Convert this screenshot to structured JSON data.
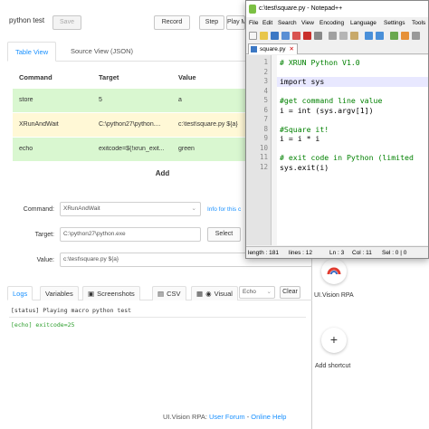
{
  "uivision": {
    "macro_name": "python test",
    "buttons": {
      "save": "Save",
      "record": "Record",
      "step": "Step",
      "play": "Play M"
    },
    "tabs": [
      "Table View",
      "Source View (JSON)"
    ],
    "columns": [
      "Command",
      "Target",
      "Value"
    ],
    "rows": [
      {
        "command": "store",
        "target": "5",
        "value": "a"
      },
      {
        "command": "XRunAndWait",
        "target": "C:\\python27\\python....",
        "value": "c:\\test\\square.py ${a}"
      },
      {
        "command": "echo",
        "target": "exitcode=${!xrun_exit...",
        "value": "green"
      }
    ],
    "add_label": "Add",
    "form": {
      "command_label": "Command:",
      "command_value": "XRunAndWait",
      "info_link": "Info for this c",
      "target_label": "Target:",
      "target_value": "C:\\python27\\python.exe",
      "select_button": "Select",
      "value_label": "Value:",
      "value_value": "c:\\test\\square.py ${a}"
    },
    "bottom_tabs": [
      "Logs",
      "Variables",
      "Screenshots",
      "CSV",
      "Visual"
    ],
    "echo_select": "Echo",
    "clear_button": "Clear",
    "logs": [
      {
        "tag": "[status]",
        "text": "Playing macro python test",
        "color": "#333333"
      },
      {
        "tag": "[echo]",
        "text": "exitcode=25",
        "color": "#2a9d2a"
      }
    ],
    "footer": {
      "prefix": "UI.Vision RPA:",
      "forum": "User Forum",
      "sep": " - ",
      "help": "Online Help"
    }
  },
  "sidebar": {
    "items": [
      {
        "label": "UI.Vision RPA",
        "icon": "uivision-logo-icon"
      },
      {
        "label": "Add shortcut",
        "icon": "plus-icon",
        "glyph": "+"
      }
    ]
  },
  "notepad": {
    "title": "c:\\test\\square.py - Notepad++",
    "menu": [
      "File",
      "Edit",
      "Search",
      "View",
      "Encoding",
      "Language",
      "Settings",
      "Tools"
    ],
    "tab": "square.py",
    "line_numbers": [
      "1",
      "2",
      "3",
      "4",
      "5",
      "6",
      "7",
      "8",
      "9",
      "10",
      "11",
      "12"
    ],
    "code_lines": [
      {
        "text": "# XRUN Python V1.0",
        "color": "#008000"
      },
      {
        "text": "",
        "color": "#000000"
      },
      {
        "text": "import sys",
        "color": "#000000"
      },
      {
        "text": "",
        "color": "#000000"
      },
      {
        "text": "#get command line value",
        "color": "#008000"
      },
      {
        "text": "i = int (sys.argv[1])",
        "color": "#000000"
      },
      {
        "text": "",
        "color": "#000000"
      },
      {
        "text": "#Square it!",
        "color": "#008000"
      },
      {
        "text": "i = i * i",
        "color": "#000000"
      },
      {
        "text": "",
        "color": "#000000"
      },
      {
        "text": "# exit code in Python (limited",
        "color": "#008000"
      },
      {
        "text": "sys.exit(i)",
        "color": "#000000"
      }
    ],
    "status": {
      "length": "length : 181",
      "lines": "lines : 12",
      "ln": "Ln : 3",
      "col": "Col : 11",
      "sel": "Sel : 0 | 0"
    }
  }
}
